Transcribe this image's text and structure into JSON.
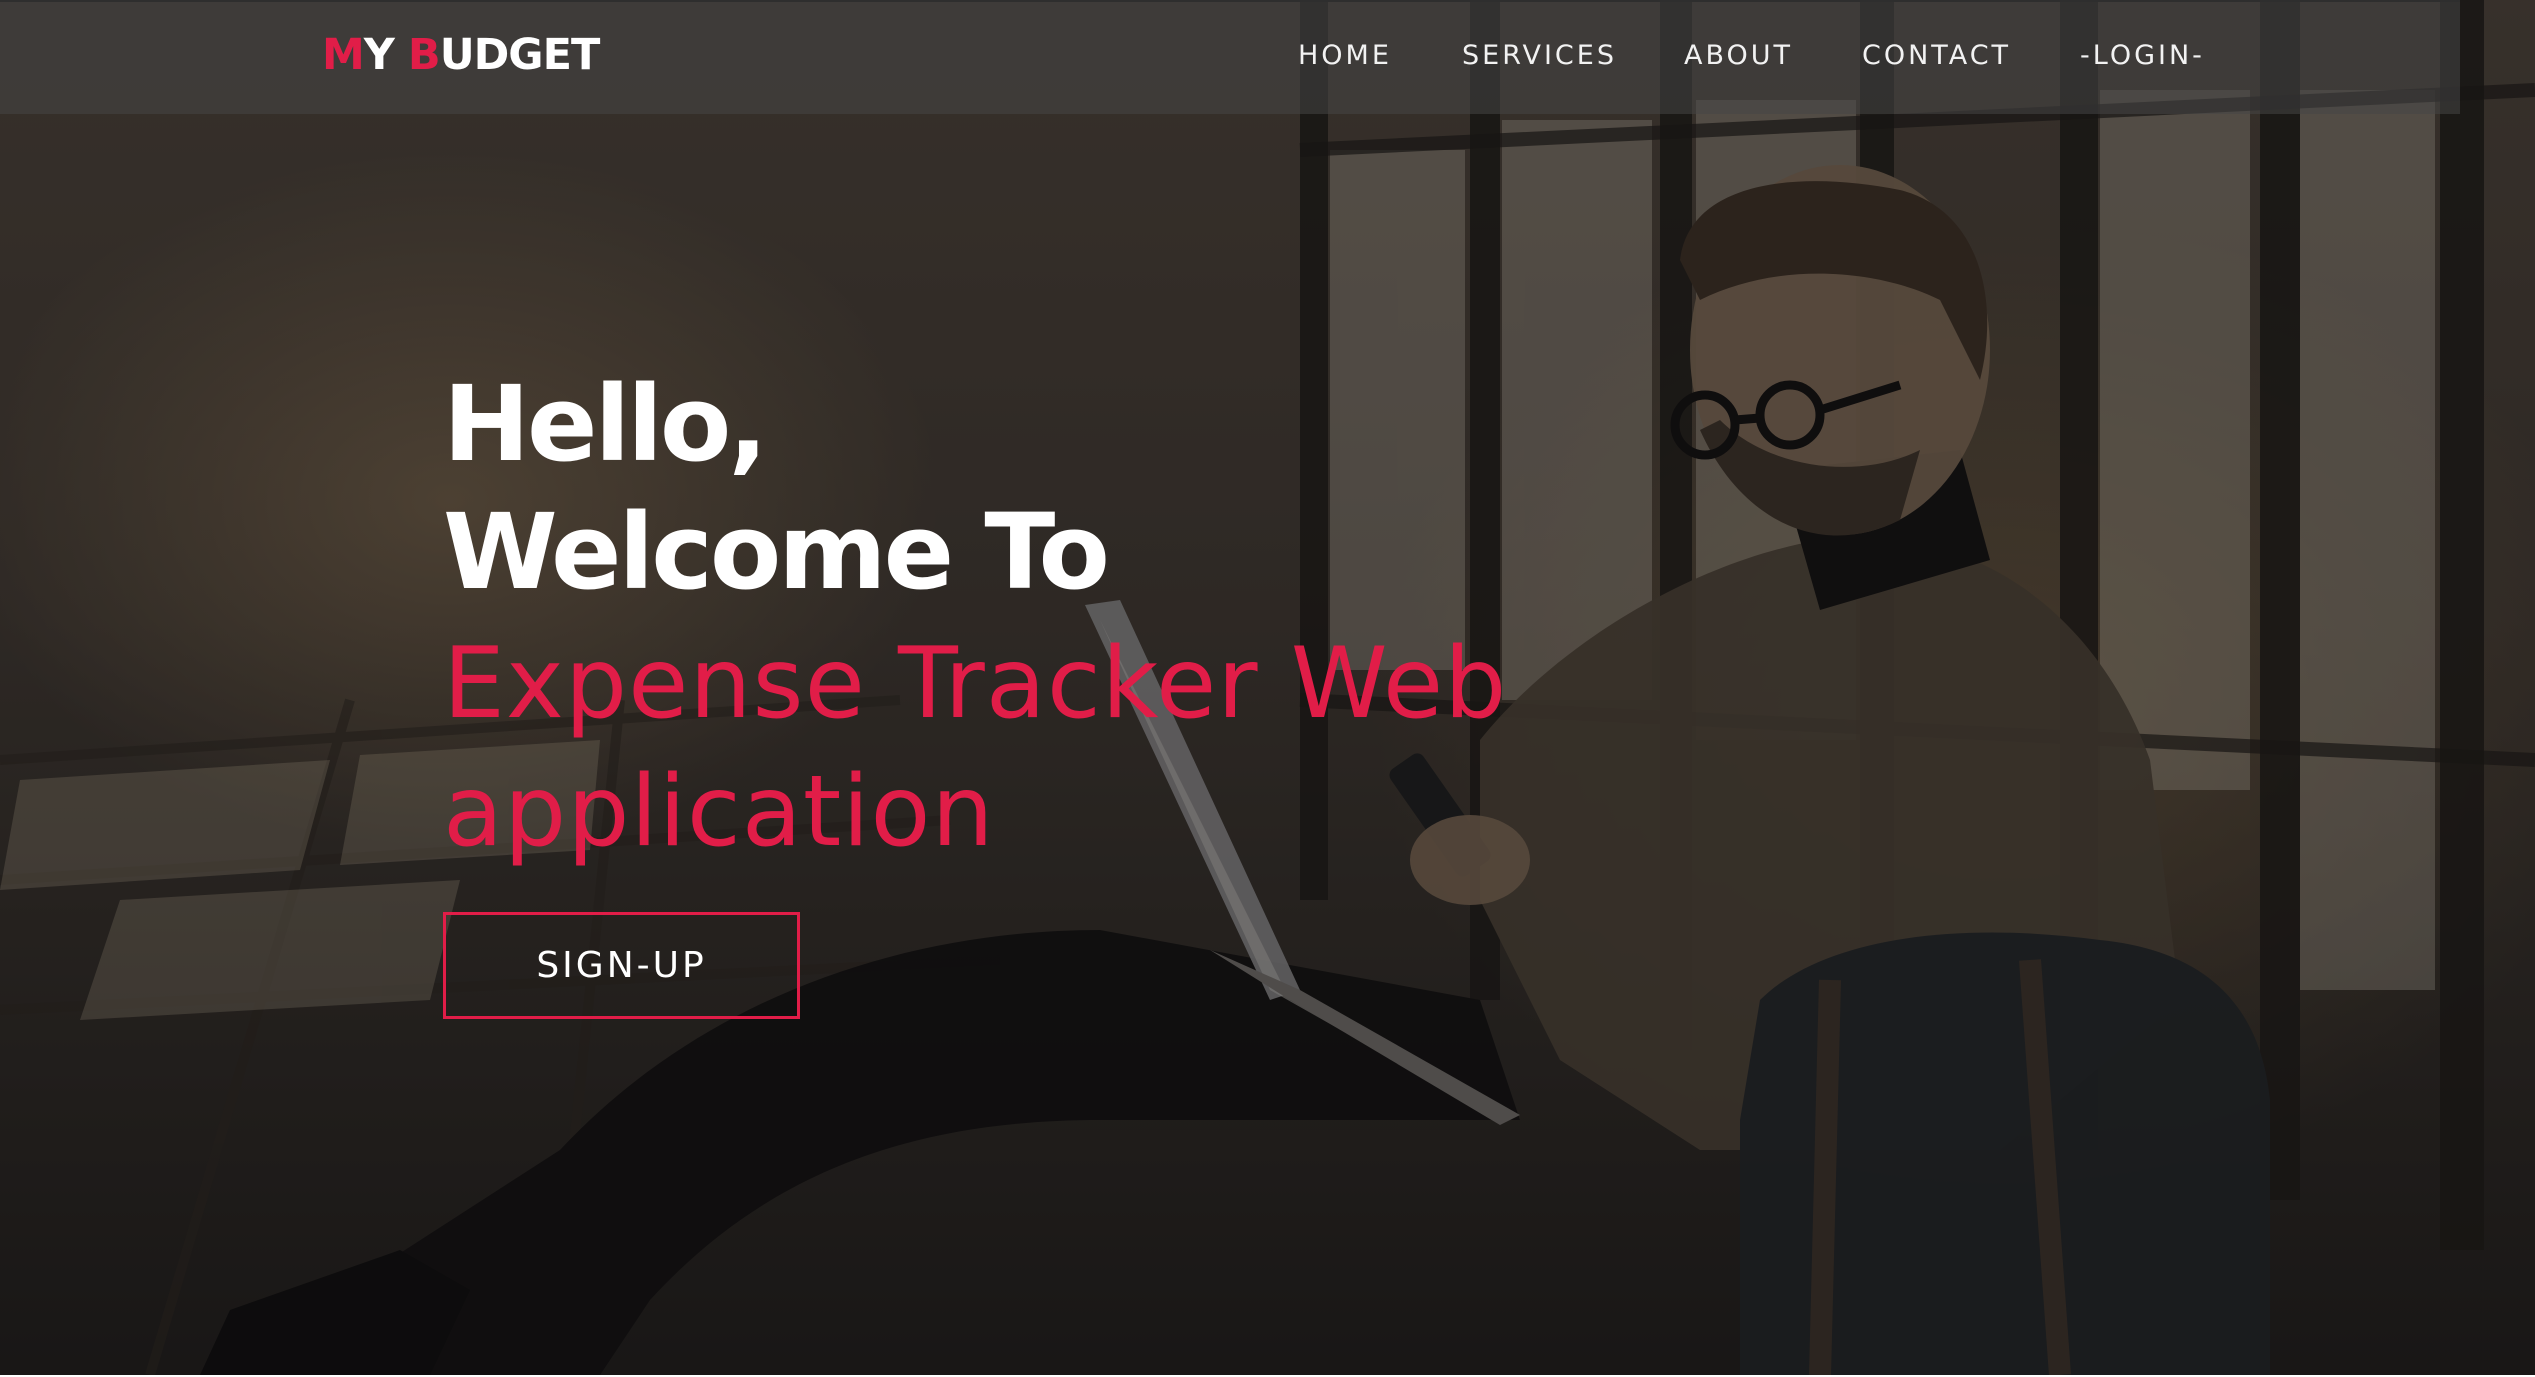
{
  "brand": {
    "logo_first_initial": "M",
    "logo_first_rest": "Y ",
    "logo_second_initial": "B",
    "logo_second_rest": "UDGET",
    "accent_color": "#e11d48"
  },
  "nav": {
    "items": [
      {
        "label": "HOME"
      },
      {
        "label": "SERVICES"
      },
      {
        "label": "ABOUT"
      },
      {
        "label": "CONTACT"
      },
      {
        "label": "-LOGIN-"
      }
    ]
  },
  "hero": {
    "greeting": "Hello,",
    "welcome": "Welcome To",
    "app_line1": "Expense Tracker Web",
    "app_line2": "application",
    "cta_label": "SIGN-UP"
  }
}
